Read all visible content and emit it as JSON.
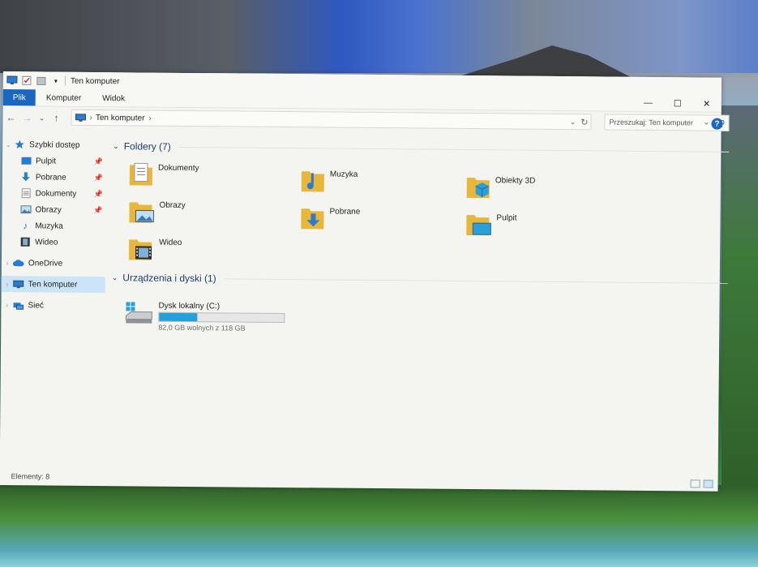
{
  "window": {
    "title": "Ten komputer",
    "controls": {
      "minimize": "—",
      "maximize": "☐",
      "close": "✕"
    }
  },
  "ribbon": {
    "tabs": [
      {
        "label": "Plik"
      },
      {
        "label": "Komputer"
      },
      {
        "label": "Widok"
      }
    ]
  },
  "nav": {
    "back": "←",
    "forward": "→",
    "recent": "⌄",
    "up": "↑",
    "address_crumb": "Ten komputer",
    "address_sep": "›",
    "search_placeholder": "Przeszukaj: Ten komputer",
    "help": "?"
  },
  "sidebar": {
    "quick_access": "Szybki dostęp",
    "items": [
      {
        "label": "Pulpit",
        "pinned": true
      },
      {
        "label": "Pobrane",
        "pinned": true
      },
      {
        "label": "Dokumenty",
        "pinned": true
      },
      {
        "label": "Obrazy",
        "pinned": true
      },
      {
        "label": "Muzyka",
        "pinned": false
      },
      {
        "label": "Wideo",
        "pinned": false
      }
    ],
    "onedrive": "OneDrive",
    "this_pc": "Ten komputer",
    "network": "Sieć"
  },
  "folders": {
    "header": "Foldery (7)",
    "items": [
      {
        "label": "Dokumenty",
        "icon": "documents-folder-icon"
      },
      {
        "label": "Muzyka",
        "icon": "music-folder-icon"
      },
      {
        "label": "Obiekty 3D",
        "icon": "3d-objects-folder-icon"
      },
      {
        "label": "Obrazy",
        "icon": "pictures-folder-icon"
      },
      {
        "label": "Pobrane",
        "icon": "downloads-folder-icon"
      },
      {
        "label": "Pulpit",
        "icon": "desktop-folder-icon"
      },
      {
        "label": "Wideo",
        "icon": "videos-folder-icon"
      }
    ]
  },
  "devices": {
    "header": "Urządzenia i dyski (1)",
    "drive": {
      "label": "Dysk lokalny (C:)",
      "free_text": "82,0 GB wolnych z 118 GB",
      "used_fraction": 0.305
    }
  },
  "status": {
    "items": "Elementy: 8"
  },
  "colors": {
    "accent": "#1a67c0",
    "selection": "#cce4f7",
    "folder": "#e8b73a",
    "drive_bar": "#26a0da"
  }
}
